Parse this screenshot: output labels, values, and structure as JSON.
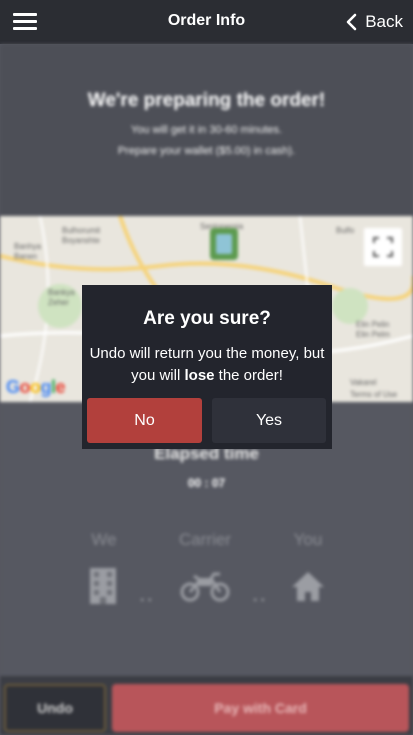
{
  "header": {
    "title": "Order Info",
    "back_label": "Back"
  },
  "status": {
    "title": "We're preparing the order!",
    "line1": "You will get it in 30-60 minutes.",
    "line2": "Prepare your wallet ($5.00) in cash)."
  },
  "map": {
    "labels": [
      "Sentoperpia",
      "Bulhorumit",
      "Boyanshte",
      "Banhya",
      "Banen",
      "Bulfo",
      "Bankya",
      "Zeher",
      "Elin Pelin",
      "Elin Pelm",
      "Vakarel",
      "Terms of Use"
    ],
    "google": [
      "G",
      "o",
      "o",
      "g",
      "l",
      "e"
    ],
    "google_colors": [
      "#4285f4",
      "#ea4335",
      "#fbbc05",
      "#4285f4",
      "#34a853",
      "#ea4335"
    ]
  },
  "timer": {
    "label": "Elapsed time",
    "value": "00 : 07"
  },
  "progress": {
    "steps": [
      "We",
      "Carrier",
      "You"
    ],
    "icons": [
      "building-icon",
      "motorcycle-icon",
      "house-icon"
    ],
    "dots": ".."
  },
  "actions": {
    "undo_label": "Undo",
    "pay_label": "Pay with Card"
  },
  "dialog": {
    "title": "Are you sure?",
    "body_before": "Undo will return you the money, but you will ",
    "body_bold": "lose",
    "body_after": " the order!",
    "no_label": "No",
    "yes_label": "Yes"
  },
  "colors": {
    "top_bar": "#2b2d33",
    "dialog_bg": "#23252d",
    "no_button": "#b2403c",
    "yes_button": "#2f313a",
    "pay_button": "#b8555a"
  }
}
